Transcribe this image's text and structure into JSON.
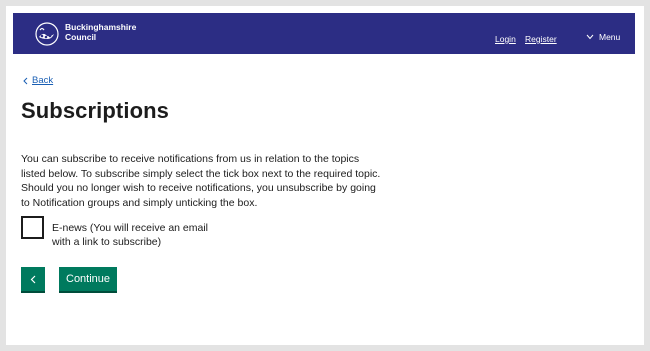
{
  "header": {
    "brand_line1": "Buckinghamshire",
    "brand_line2": "Council",
    "login_label": "Login",
    "register_label": "Register",
    "menu_label": "Menu",
    "logo_icon": "swan-logo-icon",
    "background_color": "#2c2d84"
  },
  "back_link": {
    "label": "Back",
    "icon": "chevron-left-icon"
  },
  "page_title": "Subscriptions",
  "intro_text": "You can subscribe to receive notifications from us in relation to the topics listed below. To subscribe simply select the tick box next to the required topic. Should you no longer wish to receive notifications, you unsubscribe by going to Notification groups and simply unticking the box.",
  "subscriptions": [
    {
      "label": "E-news (You will receive an email with a link to subscribe)",
      "checked": false
    }
  ],
  "actions": {
    "back_button_icon": "chevron-left-icon",
    "continue_label": "Continue",
    "button_color": "#007a5e"
  }
}
